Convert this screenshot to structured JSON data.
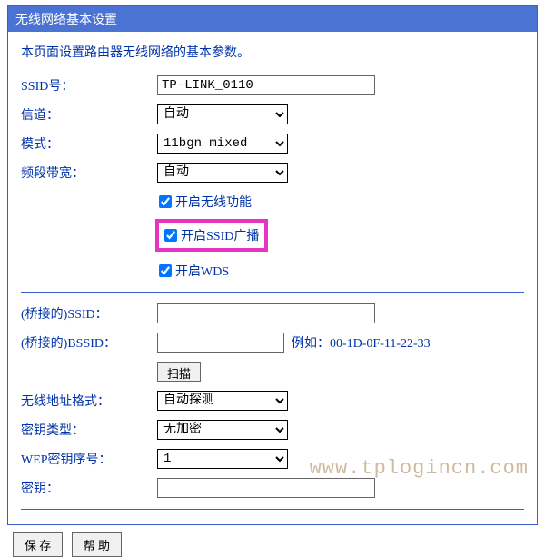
{
  "panel": {
    "title": "无线网络基本设置",
    "description": "本页面设置路由器无线网络的基本参数。"
  },
  "fields": {
    "ssid_label": "SSID号：",
    "ssid_value": "TP-LINK_0110",
    "channel_label": "信道：",
    "channel_value": "自动",
    "mode_label": "模式：",
    "mode_value": "11bgn mixed",
    "bandwidth_label": "频段带宽：",
    "bandwidth_value": "自动"
  },
  "checkboxes": {
    "enable_wireless": "开启无线功能",
    "enable_ssid_broadcast": "开启SSID广播",
    "enable_wds": "开启WDS"
  },
  "bridge": {
    "ssid_label": "(桥接的)SSID：",
    "ssid_value": "",
    "bssid_label": "(桥接的)BSSID：",
    "bssid_value": "",
    "bssid_hint": "例如：00-1D-0F-11-22-33",
    "scan_btn": "扫描",
    "addr_format_label": "无线地址格式：",
    "addr_format_value": "自动探测",
    "key_type_label": "密钥类型：",
    "key_type_value": "无加密",
    "wep_index_label": "WEP密钥序号：",
    "wep_index_value": "1",
    "key_label": "密钥：",
    "key_value": ""
  },
  "buttons": {
    "save": "保 存",
    "help": "帮 助"
  },
  "watermark": "www.tplogincn.com"
}
